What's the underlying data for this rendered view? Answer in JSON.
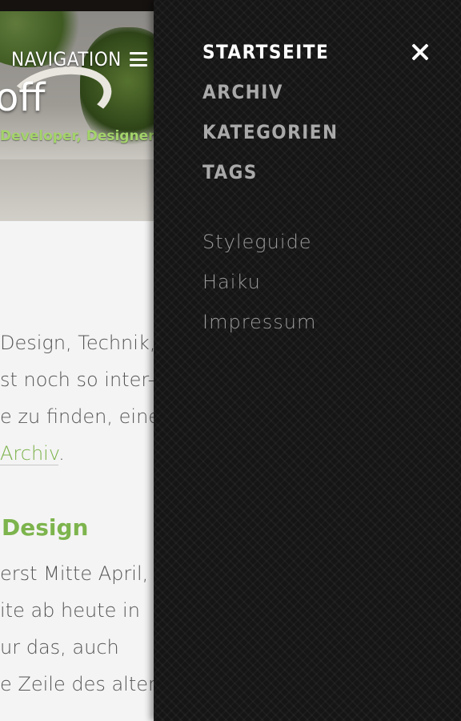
{
  "header": {
    "nav_label": "NAVIGATION",
    "site_title": "off",
    "tagline": "Developer, Designer"
  },
  "content": {
    "lines": [
      "Design, Technik,",
      "st noch so inter-",
      "e zu finden, eine"
    ],
    "archive_link": "Archiv",
    "archive_suffix": ".",
    "heading": "Design",
    "lines2": [
      "erst Mitte April,",
      "ite ab heute in",
      "ur das, auch",
      "e Zeile des alten"
    ]
  },
  "drawer": {
    "primary": [
      "STARTSEITE",
      "ARCHIV",
      "KATEGORIEN",
      "TAGS"
    ],
    "secondary": [
      "Styleguide",
      "Haiku",
      "Impressum"
    ],
    "close_icon": "close-icon"
  },
  "colors": {
    "accent": "#7bb24a",
    "drawer_bg": "#151515"
  }
}
